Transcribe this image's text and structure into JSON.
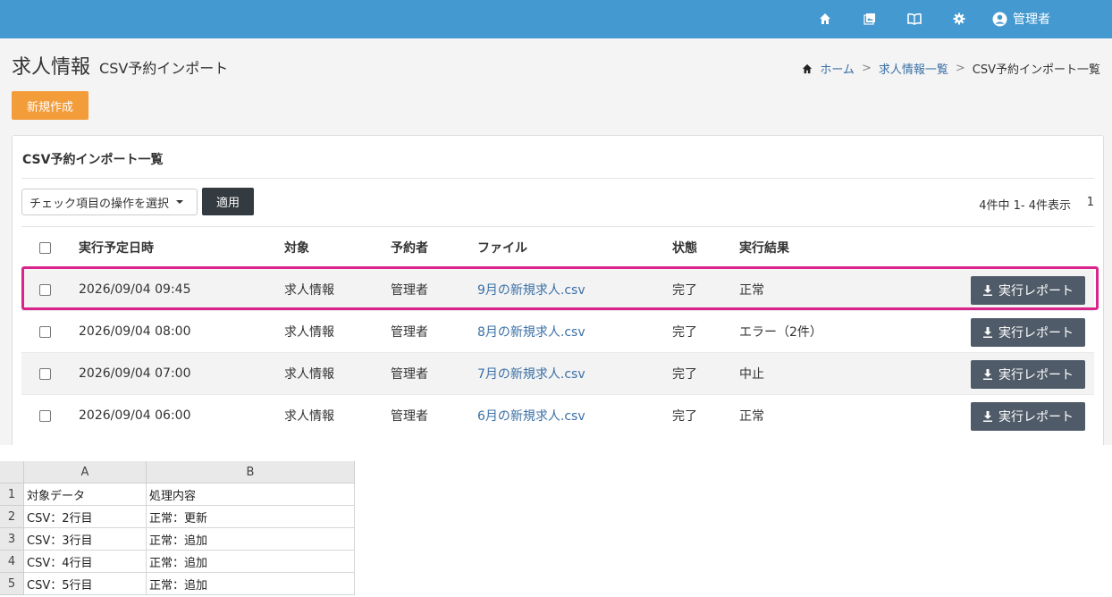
{
  "header": {
    "user_name": "管理者",
    "icons": [
      "home-icon",
      "image-icon",
      "book-icon",
      "gear-icon",
      "user-circle-icon"
    ],
    "bg_color": "#4499d0"
  },
  "page": {
    "title": "求人情報",
    "subtitle": "CSV予約インポート",
    "breadcrumb": [
      "ホーム",
      "求人情報一覧",
      "CSV予約インポート一覧"
    ],
    "new_button": "新規作成"
  },
  "panel": {
    "title": "CSV予約インポート一覧",
    "bulk_select": "チェック項目の操作を選択",
    "apply_button": "適用",
    "count_text": "4件中 1- 4件表示",
    "page_number": "1",
    "columns": [
      "実行予定日時",
      "対象",
      "予約者",
      "ファイル",
      "状態",
      "実行結果"
    ],
    "rows": [
      {
        "datetime": "2026/09/04 09:45",
        "target": "求人情報",
        "user": "管理者",
        "file": "9月の新規求人.csv",
        "status": "完了",
        "result": "正常",
        "report": "実行レポート"
      },
      {
        "datetime": "2026/09/04 08:00",
        "target": "求人情報",
        "user": "管理者",
        "file": "8月の新規求人.csv",
        "status": "完了",
        "result": "エラー（2件）",
        "report": "実行レポート"
      },
      {
        "datetime": "2026/09/04 07:00",
        "target": "求人情報",
        "user": "管理者",
        "file": "7月の新規求人.csv",
        "status": "完了",
        "result": "中止",
        "report": "実行レポート"
      },
      {
        "datetime": "2026/09/04 06:00",
        "target": "求人情報",
        "user": "管理者",
        "file": "6月の新規求人.csv",
        "status": "完了",
        "result": "正常",
        "report": "実行レポート"
      }
    ]
  },
  "sheet": {
    "col_headers": [
      "A",
      "B"
    ],
    "row_numbers": [
      "1",
      "2",
      "3",
      "4",
      "5"
    ],
    "cells": [
      [
        "対象データ",
        "処理内容"
      ],
      [
        "CSV：2行目",
        "正常：更新"
      ],
      [
        "CSV：3行目",
        "正常：追加"
      ],
      [
        "CSV：4行目",
        "正常：追加"
      ],
      [
        "CSV：5行目",
        "正常：追加"
      ]
    ]
  }
}
